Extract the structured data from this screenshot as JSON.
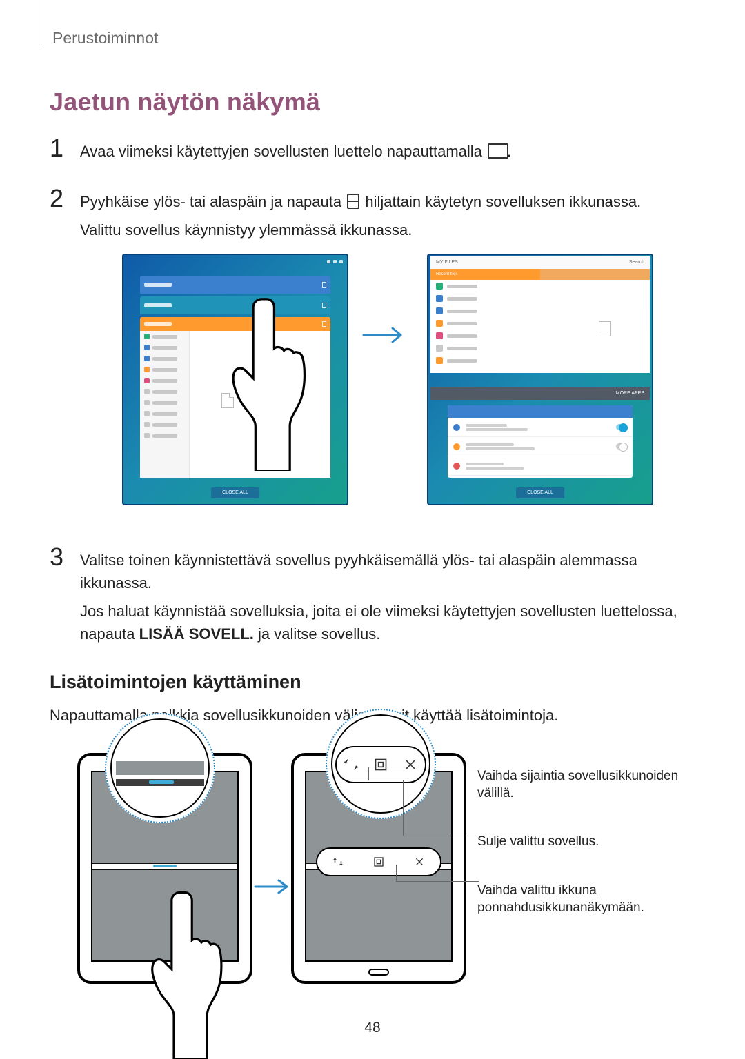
{
  "header": {
    "breadcrumb": "Perustoiminnot"
  },
  "title": "Jaetun näytön näkymä",
  "steps": {
    "s1": {
      "num": "1",
      "text": "Avaa viimeksi käytettyjen sovellusten luettelo napauttamalla "
    },
    "s2": {
      "num": "2",
      "text_a": "Pyyhkäise ylös- tai alaspäin ja napauta ",
      "text_b": " hiljattain käytetyn sovelluksen ikkunassa.",
      "text_c": "Valittu sovellus käynnistyy ylemmässä ikkunassa."
    },
    "s3": {
      "num": "3",
      "text_a": "Valitse toinen käynnistettävä sovellus pyyhkäisemällä ylös- tai alaspäin alemmassa ikkunassa.",
      "text_b": "Jos haluat käynnistää sovelluksia, joita ei ole viimeksi käytettyjen sovellusten luettelossa, napauta ",
      "bold": "LISÄÄ SOVELL.",
      "text_c": " ja valitse sovellus."
    }
  },
  "section2": {
    "heading": "Lisätoimintojen käyttäminen",
    "text": "Napauttamalla palkkia sovellusikkunoiden välissä voit käyttää lisätoimintoja."
  },
  "callouts": {
    "c1": "Vaihda sijaintia sovellusikkunoiden välillä.",
    "c2": "Sulje valittu sovellus.",
    "c3": "Vaihda valittu ikkuna ponnahdusikkunanäkymään."
  },
  "illus1": {
    "pill": "CLOSE ALL",
    "topbar": "MY FILES",
    "search": "Search",
    "tab_a": "Recent files",
    "tab_b": "",
    "more": "MORE APPS"
  },
  "page_number": "48"
}
